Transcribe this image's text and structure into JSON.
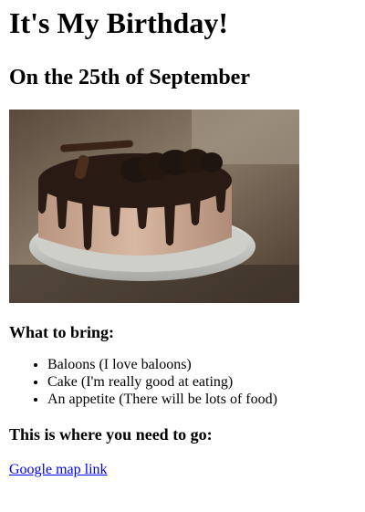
{
  "title": "It's My Birthday!",
  "subtitle": "On the 25th of September",
  "image": {
    "alt": "chocolate-drip-cake"
  },
  "bring": {
    "heading": "What to bring:",
    "items": [
      "Baloons (I love baloons)",
      "Cake (I'm really good at eating)",
      "An appetite (There will be lots of food)"
    ]
  },
  "location": {
    "heading": "This is where you need to go:",
    "link_text": "Google map link"
  },
  "colors": {
    "link": "#0000ee",
    "text": "#000000"
  }
}
